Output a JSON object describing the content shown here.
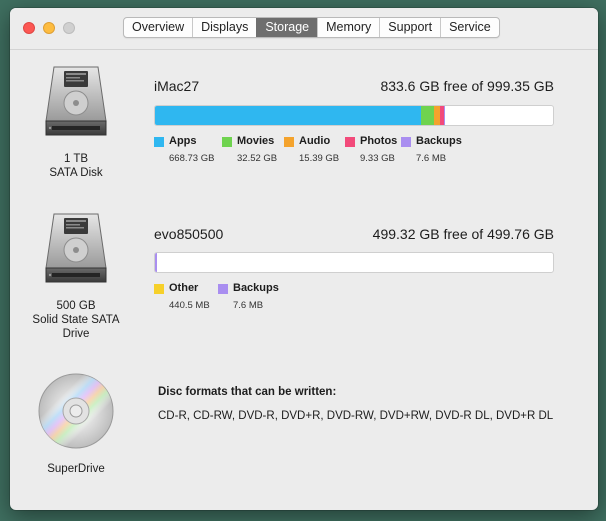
{
  "tabs": [
    {
      "label": "Overview",
      "active": false
    },
    {
      "label": "Displays",
      "active": false
    },
    {
      "label": "Storage",
      "active": true
    },
    {
      "label": "Memory",
      "active": false
    },
    {
      "label": "Support",
      "active": false
    },
    {
      "label": "Service",
      "active": false
    }
  ],
  "drives": [
    {
      "icon": "hard-disk-icon",
      "label_lines": [
        "1 TB",
        "SATA Disk"
      ],
      "volume": "iMac27",
      "free_text": "833.6 GB free of 999.35 GB",
      "legend": [
        {
          "name": "Apps",
          "size": "668.73 GB",
          "color": "#2fb7f0"
        },
        {
          "name": "Movies",
          "size": "32.52 GB",
          "color": "#6fd34f"
        },
        {
          "name": "Audio",
          "size": "15.39 GB",
          "color": "#f4a32d"
        },
        {
          "name": "Photos",
          "size": "9.33 GB",
          "color": "#f24a7a"
        },
        {
          "name": "Backups",
          "size": "7.6 MB",
          "color": "#a98ef0"
        }
      ]
    },
    {
      "icon": "hard-disk-icon",
      "label_lines": [
        "500 GB",
        "Solid State SATA",
        "Drive"
      ],
      "volume": "evo850500",
      "free_text": "499.32 GB free of 499.76 GB",
      "legend": [
        {
          "name": "Other",
          "size": "440.5 MB",
          "color": "#f6d02a"
        },
        {
          "name": "Backups",
          "size": "7.6 MB",
          "color": "#a98ef0"
        }
      ]
    }
  ],
  "superdrive": {
    "icon": "optical-disc-icon",
    "label": "SuperDrive",
    "heading": "Disc formats that can be written:",
    "formats": "CD-R, CD-RW, DVD-R, DVD+R, DVD-RW, DVD+RW, DVD-R DL, DVD+R DL"
  },
  "colors": {
    "accent_tab": "#6e6e6e",
    "close": "#fc5753",
    "minimize": "#fdbc40"
  }
}
